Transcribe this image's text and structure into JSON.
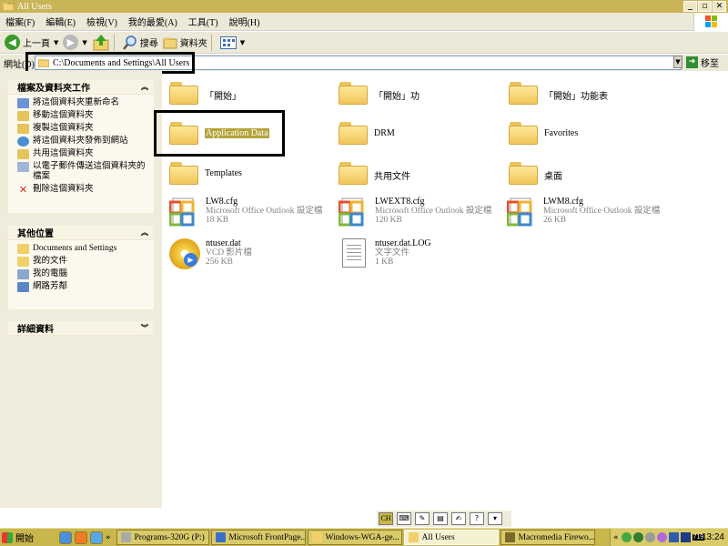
{
  "window": {
    "title": "All Users"
  },
  "menu": [
    "檔案(F)",
    "編輯(E)",
    "檢視(V)",
    "我的最愛(A)",
    "工具(T)",
    "說明(H)"
  ],
  "toolbar": {
    "back": "上一頁",
    "search": "搜尋",
    "folders": "資料夾"
  },
  "address": {
    "label": "網址(D)",
    "path": "C:\\Documents and Settings\\All Users",
    "go": "移至"
  },
  "tasks_panel": {
    "title": "檔案及資料夾工作",
    "items": [
      "將這個資料夾重新命名",
      "移動這個資料夾",
      "複製這個資料夾",
      "將這個資料夾發佈到網站",
      "共用這個資料夾",
      "以電子郵件傳送這個資料夾的檔案",
      "刪除這個資料夾"
    ]
  },
  "places_panel": {
    "title": "其他位置",
    "items": [
      "Documents and Settings",
      "我的文件",
      "我的電腦",
      "網路芳鄰"
    ]
  },
  "details_panel": {
    "title": "詳細資料"
  },
  "files": [
    {
      "name": "「開始」"
    },
    {
      "name": "「開始」功"
    },
    {
      "name": "「開始」功能表"
    },
    {
      "name": "Application Data"
    },
    {
      "name": "DRM"
    },
    {
      "name": "Favorites"
    },
    {
      "name": "Templates"
    },
    {
      "name": "共用文件"
    },
    {
      "name": "桌面"
    },
    {
      "name": "LW8.cfg",
      "type": "Microsoft Office Outlook 設定檔",
      "size": "18 KB"
    },
    {
      "name": "LWEXT8.cfg",
      "type": "Microsoft Office Outlook 設定檔",
      "size": "120 KB"
    },
    {
      "name": "LWM8.cfg",
      "type": "Microsoft Office Outlook 設定檔",
      "size": "26 KB"
    },
    {
      "name": "ntuser.dat",
      "type": "VCD 影片檔",
      "size": "256 KB"
    },
    {
      "name": "ntuser.dat.LOG",
      "type": "文字文件",
      "size": "1 KB"
    }
  ],
  "langbar": {
    "mode": "CH"
  },
  "taskbar": {
    "start": "開始",
    "buttons": [
      "Programs-320G (P:)",
      "Microsoft FrontPage...",
      "Windows-WGA-ge...",
      "All Users",
      "Macromedia Firewo..."
    ],
    "clock": "13:24",
    "tray_badge": "719"
  },
  "colors": {
    "titlebar": "#c9b458",
    "taskbar": "#c8b74d",
    "selection": "#b4a43a",
    "annotation": "#000000"
  }
}
